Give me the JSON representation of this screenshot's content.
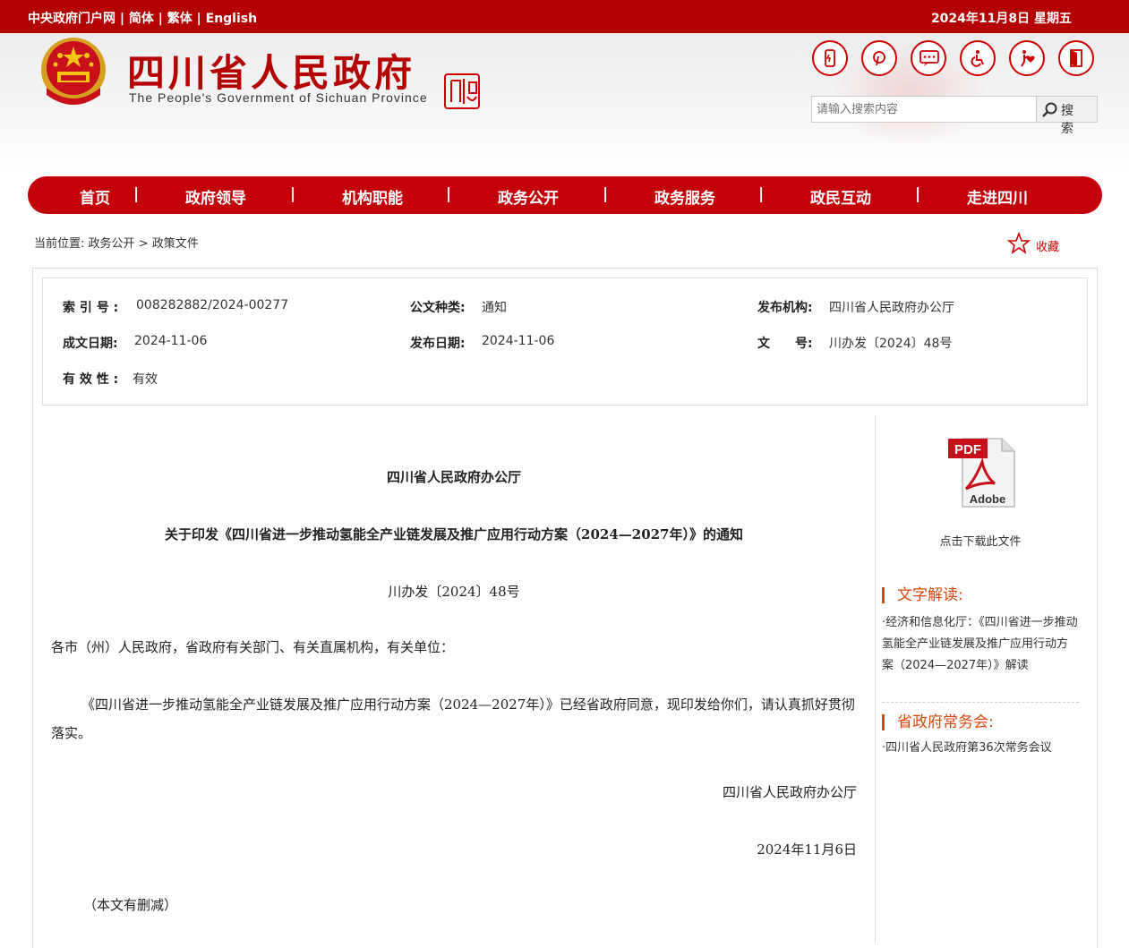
{
  "topbar": {
    "links": [
      "中央政府门户网",
      "简体",
      "繁体",
      "English"
    ],
    "separator": " | ",
    "date": "2024年11月8日 星期五"
  },
  "header": {
    "title": "四川省人民政府",
    "subtitle": "The People's Government of Sichuan Province",
    "seal_text": "中國四川",
    "tool_icons": [
      "mobile-icon",
      "weibo-icon",
      "message-icon",
      "accessibility-icon",
      "elder-care-icon",
      "exit-icon"
    ]
  },
  "search": {
    "placeholder": "请输入搜索内容",
    "button_label": "搜 索"
  },
  "nav": {
    "items": [
      "首页",
      "政府领导",
      "机构职能",
      "政务公开",
      "政务服务",
      "政民互动",
      "走进四川"
    ],
    "separator": "|"
  },
  "breadcrumb": {
    "prefix": "当前位置:",
    "items": [
      "政务公开",
      "政策文件"
    ],
    "sep": ">"
  },
  "favorite_label": "收藏",
  "meta": {
    "index_no_label": "索 引 号 :",
    "index_no": "008282882/2024-00277",
    "doc_type_label": "公文种类:",
    "doc_type": "通知",
    "issuer_label": "发布机构:",
    "issuer": "四川省人民政府办公厅",
    "created_label": "成文日期:",
    "created": "2024-11-06",
    "published_label": "发布日期:",
    "published": "2024-11-06",
    "doc_no_label": "文　　号:",
    "doc_no": "川办发〔2024〕48号",
    "validity_label": "有 效 性 :",
    "validity": "有效"
  },
  "doc": {
    "issuer": "四川省人民政府办公厅",
    "title": "关于印发《四川省进一步推动氢能全产业链发展及推广应用行动方案（2024—2027年）》的通知",
    "number": "川办发〔2024〕48号",
    "recipients": "各市（州）人民政府，省政府有关部门、有关直属机构，有关单位：",
    "body": "《四川省进一步推动氢能全产业链发展及推广应用行动方案（2024—2027年）》已经省政府同意，现印发给你们，请认真抓好贯彻落实。",
    "signature": "四川省人民政府办公厅",
    "date": "2024年11月6日",
    "note": "（本文有删减）"
  },
  "sidebar": {
    "pdf_label": "PDF",
    "adobe_label": "Adobe",
    "download_label": "点击下载此文件",
    "interpretation_heading": "文字解读:",
    "interpretation_item": "·经济和信息化厅：《四川省进一步推动氢能全产业链发展及推广应用行动方案（2024—2027年）》解读",
    "meeting_heading": "省政府常务会:",
    "meeting_item": "·四川省人民政府第36次常务会议"
  }
}
